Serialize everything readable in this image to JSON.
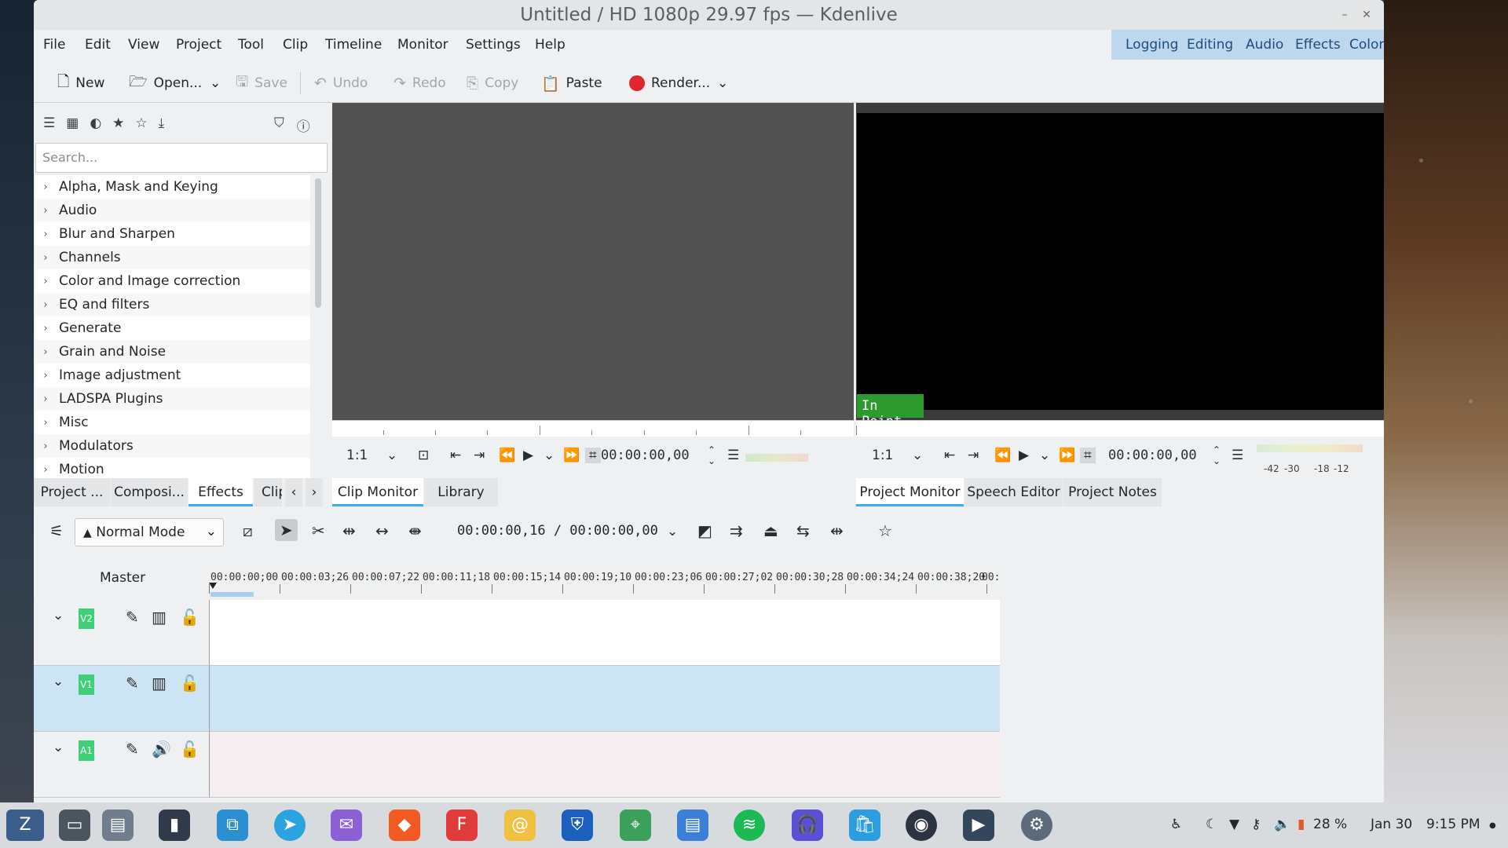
{
  "window": {
    "title": "Untitled / HD 1080p 29.97 fps — Kdenlive",
    "min_glyph": "–",
    "close_glyph": "✕"
  },
  "menu": [
    "File",
    "Edit",
    "View",
    "Project",
    "Tool",
    "Clip",
    "Timeline",
    "Monitor",
    "Settings",
    "Help"
  ],
  "layouts": [
    "Logging",
    "Editing",
    "Audio",
    "Effects",
    "Color"
  ],
  "toolbar": {
    "new": "New",
    "open": "Open...",
    "save": "Save",
    "undo": "Undo",
    "redo": "Redo",
    "copy": "Copy",
    "paste": "Paste",
    "render": "Render...",
    "render_color": "#e0262e"
  },
  "effects_panel": {
    "search_placeholder": "Search...",
    "categories": [
      "Alpha, Mask and Keying",
      "Audio",
      "Blur and Sharpen",
      "Channels",
      "Color and Image correction",
      "EQ and filters",
      "Generate",
      "Grain and Noise",
      "Image adjustment",
      "LADSPA Plugins",
      "Misc",
      "Modulators",
      "Motion"
    ]
  },
  "left_tabs": [
    "Project ...",
    "Composi...",
    "Effects",
    "Clip"
  ],
  "clip_monitor": {
    "zoom": "1:1",
    "timecode": "00:00:00,00",
    "tabs": [
      "Clip Monitor",
      "Library"
    ]
  },
  "project_monitor": {
    "in_point_label": "In Point",
    "zoom": "1:1",
    "timecode": "00:00:00,00",
    "level_labels": [
      "-42",
      "-30",
      "-18",
      "-12"
    ],
    "tabs": [
      "Project Monitor",
      "Speech Editor",
      "Project Notes"
    ]
  },
  "timeline": {
    "mode": "Normal Mode",
    "timecode": "00:00:00,16 / 00:00:00,00",
    "master_label": "Master",
    "ruler": [
      "00:00:00;00",
      "00:00:03;26",
      "00:00:07;22",
      "00:00:11;18",
      "00:00:15;14",
      "00:00:19;10",
      "00:00:23;06",
      "00:00:27;02",
      "00:00:30;28",
      "00:00:34;24",
      "00:00:38;20",
      "00:"
    ],
    "tracks": [
      {
        "tag": "V2",
        "type": "video",
        "color": "#ffffff"
      },
      {
        "tag": "V1",
        "type": "video",
        "color": "#cde4f4"
      },
      {
        "tag": "A1",
        "type": "audio",
        "color": "#f5eef1"
      }
    ]
  },
  "taskbar": {
    "battery": "28 %",
    "date": "Jan 30",
    "time": "9:15 PM"
  }
}
